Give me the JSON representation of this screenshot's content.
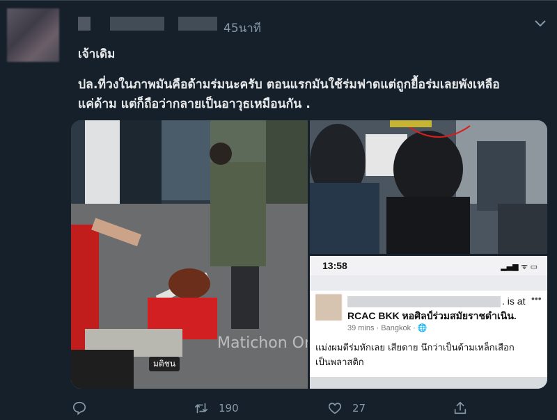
{
  "tweet": {
    "time": "45นาที",
    "handle_text": "เจ้าเดิม",
    "body_line1": "ปล.ที่วงในภาพมันคือด้ามร่มนะครับ ตอนแรกมันใช้ร่มฟาดแต่ถูกยื้อร่มเลยพังเหลือ",
    "body_line2": "แค่ด้าม แต่ก็ถือว่ากลายเป็นอาวุธเหมือนกัน ."
  },
  "media": {
    "left_watermark": "Matichon Online",
    "left_watermark_small": "มติชน",
    "phone": {
      "status_time": "13:58",
      "status_icons": "▂▄▆ ᯤ ▭",
      "fb_isat": ". is at",
      "fb_dots": "•••",
      "fb_page": "RCAC BKK หอศิลป์ร่วมสมัยราชดำเนิน.",
      "fb_meta": "39 mins · Bangkok · 🌐",
      "fb_post_line1": "แม่งผมตีร่มหักเลย เสียดาย นึกว่าเป็นด้ามเหล็กเสือก",
      "fb_post_line2": "เป็นพลาสติก"
    }
  },
  "actions": {
    "reply_count": "",
    "retweet_count": "190",
    "like_count": "27",
    "share_count": ""
  },
  "colors": {
    "background": "#15202b",
    "muted": "#8899a6",
    "text": "#e7e9ea",
    "divider": "#38444d"
  },
  "icons": {
    "reply": "reply-icon",
    "retweet": "retweet-icon",
    "like": "heart-icon",
    "share": "share-icon",
    "menu": "chevron-down-icon"
  }
}
